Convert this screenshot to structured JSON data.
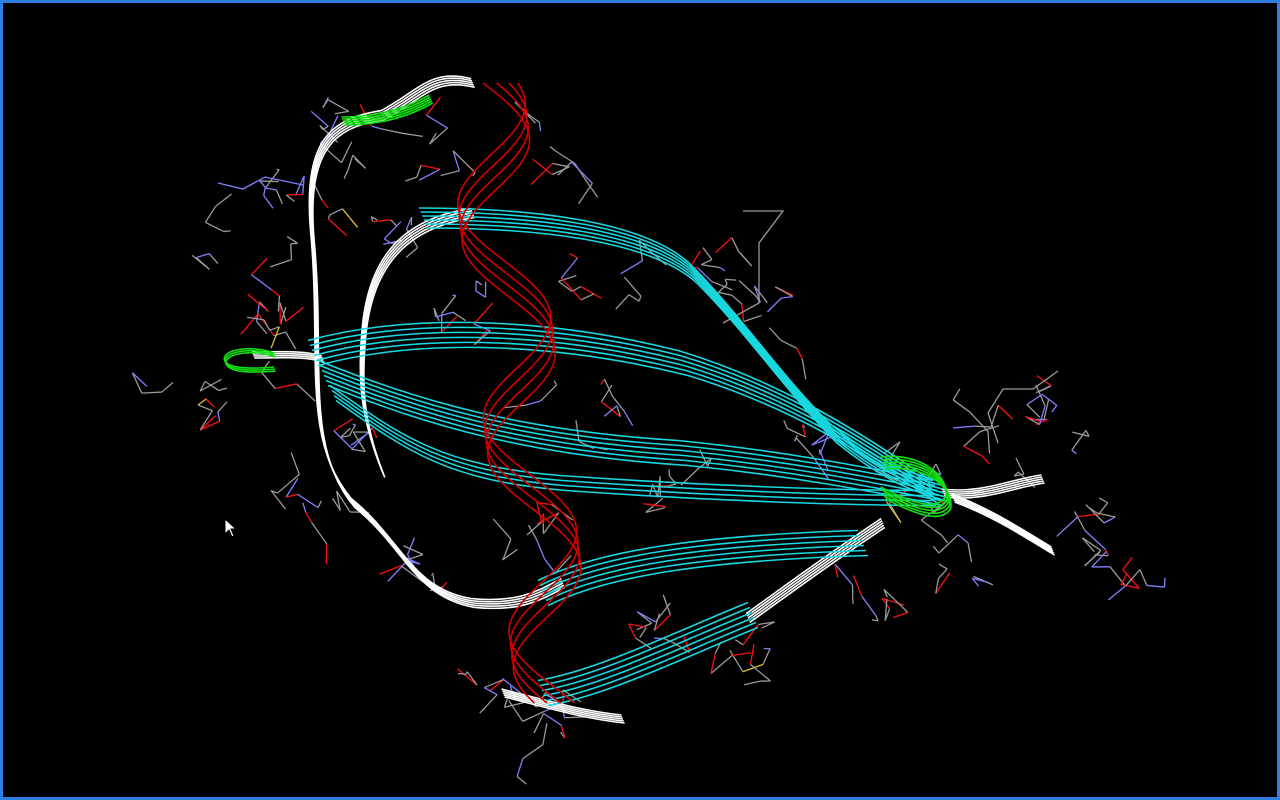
{
  "viewer": {
    "background": "#000000",
    "border_color": "#2f7fe0"
  },
  "colors": {
    "helix": "#d40000",
    "sheet": "#18d8e0",
    "turn": "#10e010",
    "coil": "#ffffff",
    "carbon": "#9a9a9a",
    "nitrogen": "#8080ff",
    "oxygen": "#ff1010",
    "sulfur": "#e0c020"
  },
  "icons": {
    "cursor": "mouse-pointer-icon"
  }
}
